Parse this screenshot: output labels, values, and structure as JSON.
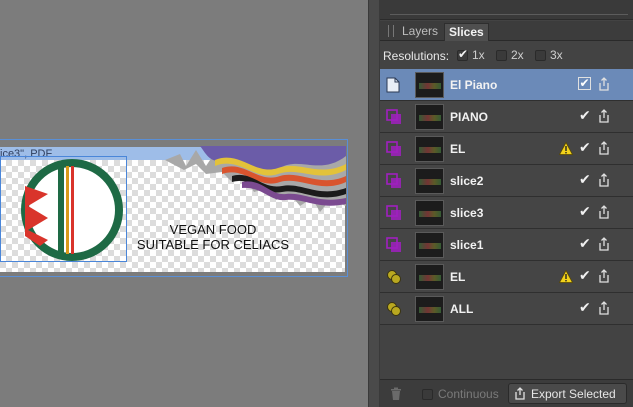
{
  "canvas": {
    "artboard_label": "ice3\", PDF",
    "text_line1": "VEGAN FOOD",
    "text_line2": "SUITABLE FOR CELIACS"
  },
  "panel": {
    "tabs": [
      {
        "label": "Layers",
        "active": false
      },
      {
        "label": "Slices",
        "active": true
      }
    ],
    "resolutions": {
      "label": "Resolutions:",
      "options": [
        {
          "label": "1x",
          "checked": true
        },
        {
          "label": "2x",
          "checked": false
        },
        {
          "label": "3x",
          "checked": false
        }
      ]
    },
    "slices": [
      {
        "name": "El Piano",
        "icon": "document-icon",
        "selected": true,
        "warning": false,
        "checked": true
      },
      {
        "name": "PIANO",
        "icon": "slice-icon",
        "selected": false,
        "warning": false,
        "checked": true
      },
      {
        "name": "EL",
        "icon": "slice-icon",
        "selected": false,
        "warning": true,
        "checked": true
      },
      {
        "name": "slice2",
        "icon": "slice-icon",
        "selected": false,
        "warning": false,
        "checked": true
      },
      {
        "name": "slice3",
        "icon": "slice-icon",
        "selected": false,
        "warning": false,
        "checked": true
      },
      {
        "name": "slice1",
        "icon": "slice-icon",
        "selected": false,
        "warning": false,
        "checked": true
      },
      {
        "name": "EL",
        "icon": "layer-slice-icon",
        "selected": false,
        "warning": true,
        "checked": true
      },
      {
        "name": "ALL",
        "icon": "layer-slice-icon",
        "selected": false,
        "warning": false,
        "checked": true
      }
    ],
    "bottom": {
      "continuous_label": "Continuous",
      "export_label": "Export Selected"
    }
  },
  "colors": {
    "selection": "#6b8ab8",
    "slice_icon": "#a020c0",
    "layer_slice_icon": "#b9a820",
    "warning": "#f2d21b"
  }
}
